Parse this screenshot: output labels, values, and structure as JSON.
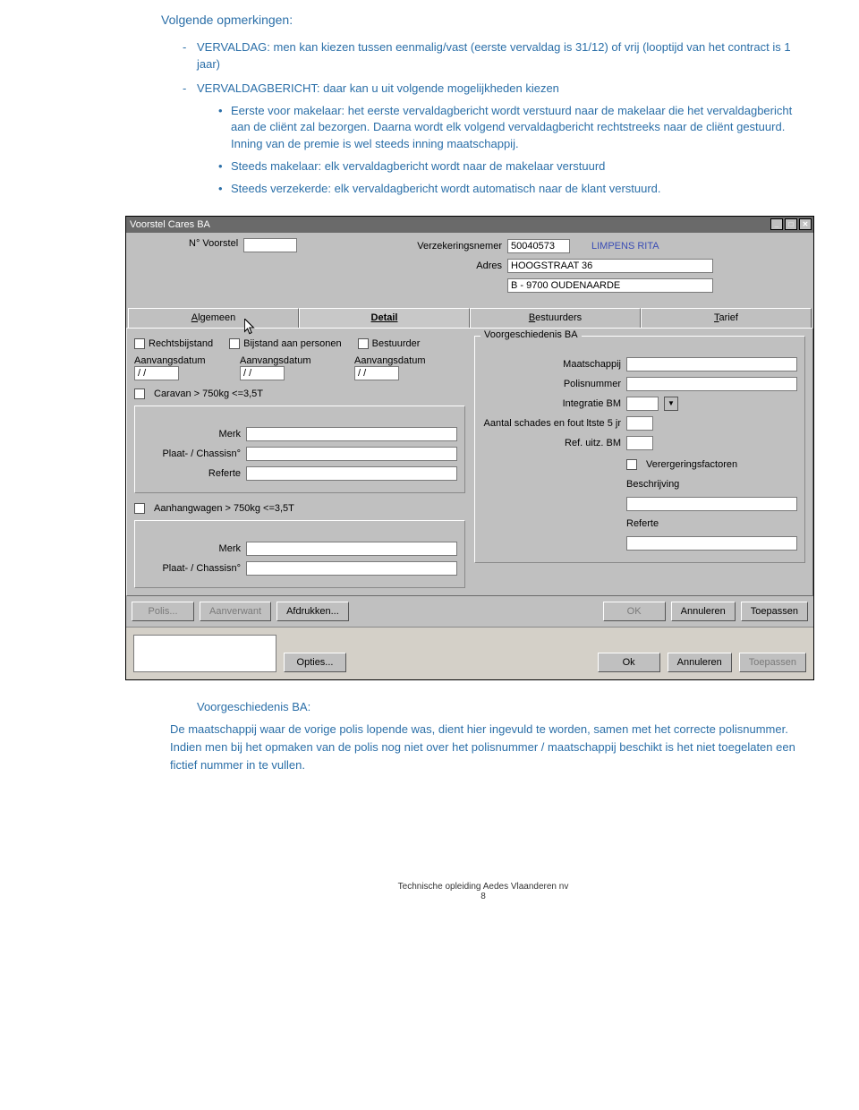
{
  "doc": {
    "heading": "Volgende opmerkingen:",
    "item1_prefix": "VERVALDAG: men kan kiezen tussen eenmalig/vast (eerste vervaldag is 31/12) of vrij (looptijd van het contract is 1 jaar)",
    "item2_prefix": "VERVALDAGBERICHT: daar kan u uit volgende mogelijkheden kiezen",
    "b1": "Eerste voor makelaar: het eerste vervaldagbericht wordt verstuurd naar de makelaar die het vervaldagbericht aan de cliënt zal bezorgen. Daarna wordt elk volgend vervaldagbericht rechtstreeks naar de cliënt gestuurd. Inning van de premie is wel steeds inning maatschappij.",
    "b2": "Steeds makelaar: elk vervaldagbericht wordt naar de makelaar verstuurd",
    "b3": "Steeds verzekerde: elk vervaldagbericht wordt automatisch naar de klant verstuurd.",
    "sub_heading": "Voorgeschiedenis BA:",
    "body_p1": "De maatschappij waar de vorige polis lopende was, dient hier ingevuld te worden, samen met het correcte polisnummer. Indien men bij het opmaken van de polis nog niet over het polisnummer / maatschappij beschikt is het niet toegelaten een fictief nummer in te vullen.",
    "footer_line1": "Technische opleiding Aedes Vlaanderen nv",
    "footer_line2": "8"
  },
  "win": {
    "title": "Voorstel Cares BA",
    "nr_voorstel_label": "N° Voorstel",
    "verzekeringsnemer_label": "Verzekeringsnemer",
    "verzekeringsnemer_value": "50040573",
    "verzekeringsnemer_name": "LIMPENS RITA",
    "adres_label": "Adres",
    "adres_line1": "HOOGSTRAAT 36",
    "adres_line2": "B - 9700 OUDENAARDE",
    "tabs": {
      "t1": "Algemeen",
      "t2": "Detail",
      "t3": "Bestuurders",
      "t4": "Tarief"
    },
    "rechtsbijstand": "Rechtsbijstand",
    "bijstand": "Bijstand aan personen",
    "bestuurder": "Bestuurder",
    "aanvangsdatum": "Aanvangsdatum",
    "date_placeholder": "/  /",
    "caravan": "Caravan > 750kg <=3,5T",
    "merk": "Merk",
    "plaat": "Plaat- / Chassisn°",
    "referte": "Referte",
    "aanhangwagen": "Aanhangwagen > 750kg <=3,5T",
    "voorgeschiedenis": "Voorgeschiedenis BA",
    "maatschappij": "Maatschappij",
    "polisnummer": "Polisnummer",
    "integratie": "Integratie BM",
    "aantal_schades": "Aantal schades en fout ltste 5 jr",
    "ref_uitz": "Ref. uitz. BM",
    "verergerings": "Verergeringsfactoren",
    "beschrijving": "Beschrijving",
    "referte2": "Referte",
    "buttons": {
      "polis": "Polis...",
      "aanverwant": "Aanverwant",
      "afdrukken": "Afdrukken...",
      "ok": "OK",
      "annuleren": "Annuleren",
      "toepassen": "Toepassen",
      "opties": "Opties...",
      "ok2": "Ok",
      "annuleren2": "Annuleren",
      "toepassen2": "Toepassen"
    }
  }
}
